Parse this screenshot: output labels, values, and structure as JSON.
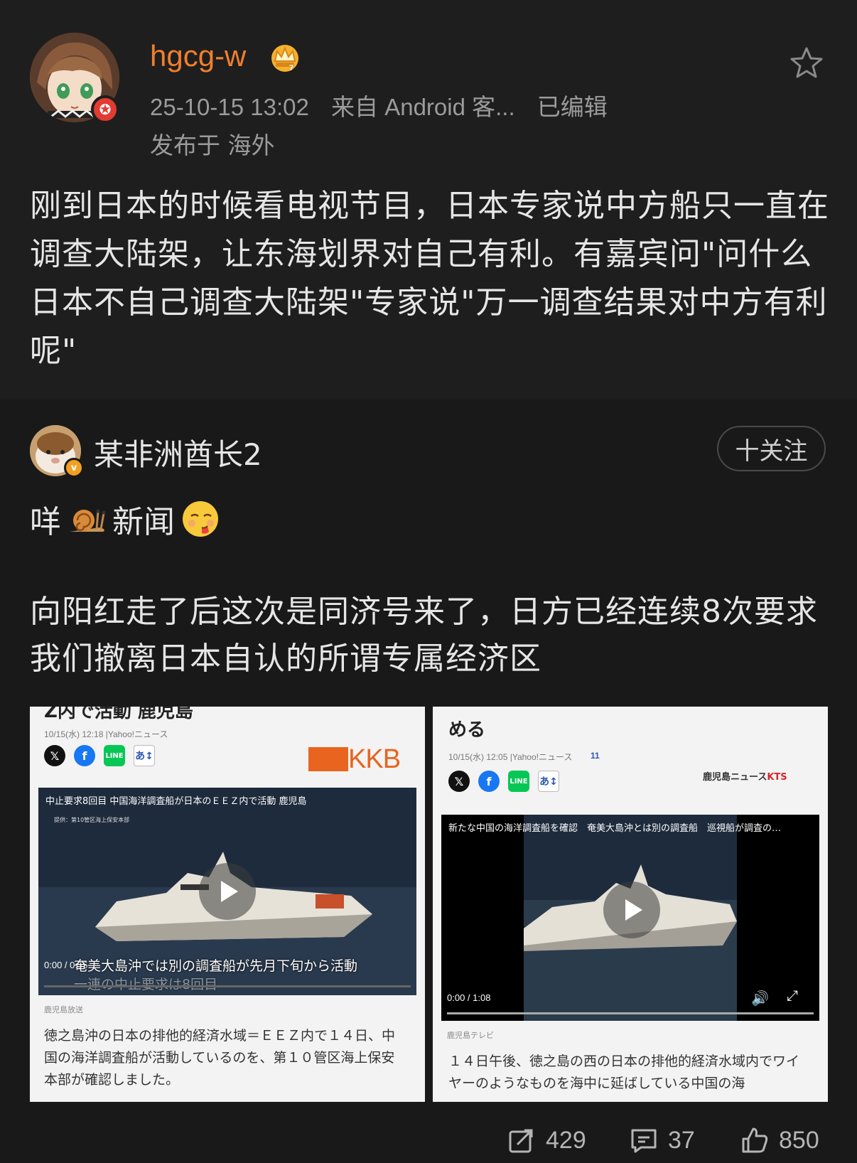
{
  "post": {
    "username": "hgcg-w",
    "timestamp": "25-10-15 13:02",
    "source": "来自 Android 客...",
    "edited": "已编辑",
    "location": "发布于 海外",
    "text": "刚到日本的时候看电视节目，日本专家说中方船只一直在调查大陆架，让东海划界对自己有利。有嘉宾问\"问什么日本不自己调查大陆架\"专家说\"万一调查结果对中方有利呢\"",
    "colors": {
      "username": "#f07f2c",
      "badge": "#e23b32"
    }
  },
  "repost": {
    "username": "某非洲酋长2",
    "follow_label": "十关注",
    "line1_a": "咩",
    "line1_b": "新闻",
    "text": "向阳红走了后这次是同济号来了，日方已经连续8次要求我们撤离日本自认的所谓专属经济区"
  },
  "cards": {
    "left": {
      "head": "Z内で活動 鹿児島",
      "date": "10/15(水) 12:18  |Yahoo!ニュース",
      "logo": "KKB",
      "video_caption": "中止要求8回目 中国海洋調査船が日本のＥＥＺ内で活動 鹿児島",
      "video_sub": "提供：第10管区海上保安本部",
      "video_time": "0:00 / 0:55",
      "video_subtitle_1": "奄美大島沖では別の調査船が先月下旬から活動",
      "video_subtitle_2": "一連の中止要求は8回目",
      "source": "鹿児島放送",
      "body": "徳之島沖の日本の排他的経済水域＝ＥＥＺ内で１４日、中国の海洋調査船が活動しているのを、第１０管区海上保安本部が確認しました。"
    },
    "right": {
      "head": "める",
      "date": "10/15(水) 12:05  |Yahoo!ニュース",
      "comments": "11",
      "logo_a": "鹿児島ニュース",
      "logo_b": "KTS",
      "video_caption": "新たな中国の海洋調査船を確認　奄美大島沖とは別の調査船　巡視船が調査の…",
      "video_time": "0:00 / 1:08",
      "source": "鹿児島テレビ",
      "body": "１４日午後、徳之島の西の日本の排他的経済水域内でワイヤーのようなものを海中に延ばしている中国の海"
    }
  },
  "footer": {
    "reposts": "429",
    "comments": "37",
    "likes": "850"
  }
}
